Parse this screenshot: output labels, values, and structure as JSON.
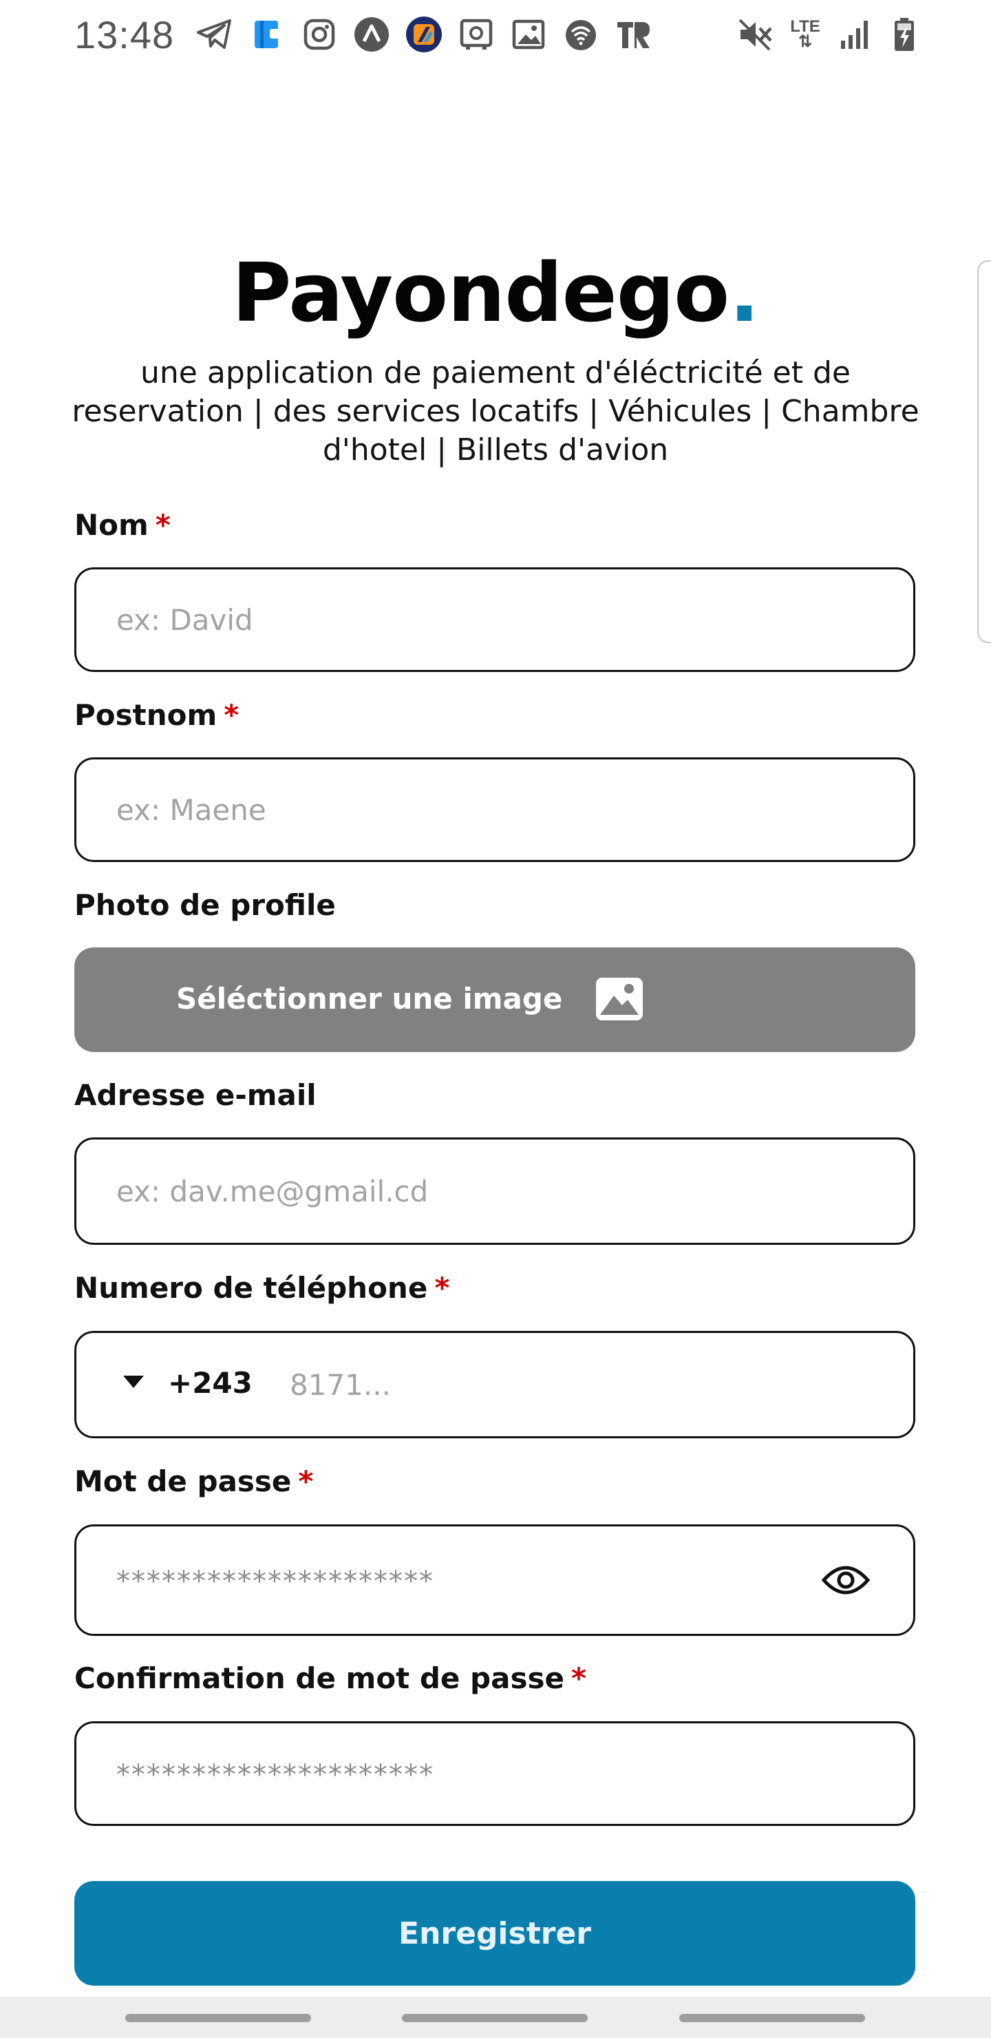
{
  "status_bar": {
    "time": "13:48",
    "left_icons": [
      "telegram-icon",
      "wallet-app-icon",
      "instagram-icon",
      "arc-app-icon",
      "boosty-app-icon",
      "safe-app-icon",
      "gallery-icon",
      "wifi-calling-icon",
      "tr-app-icon"
    ],
    "right_icons": [
      "mute-icon",
      "lte-icon",
      "signal-icon",
      "battery-charging-icon"
    ],
    "lte_label": "LTE"
  },
  "header": {
    "brand": "Payondego",
    "brand_dot": ".",
    "subtitle": "une application de paiement d'éléctricité et de reservation | des services locatifs | Véhicules | Chambre d'hotel | Billets d'avion"
  },
  "form": {
    "required_mark": "*",
    "nom": {
      "label": "Nom",
      "placeholder": "ex: David",
      "value": ""
    },
    "postnom": {
      "label": "Postnom",
      "placeholder": "ex: Maene",
      "value": ""
    },
    "photo": {
      "label": "Photo de profile",
      "button_label": "Séléctionner une image",
      "icon": "image-icon"
    },
    "email": {
      "label": "Adresse e-mail",
      "placeholder": "ex: dav.me@gmail.cd",
      "value": ""
    },
    "phone": {
      "label": "Numero de téléphone",
      "country_code": "+243",
      "placeholder": "8171...",
      "value": ""
    },
    "password": {
      "label": "Mot de passe",
      "placeholder": "*********************",
      "value": ""
    },
    "password_confirm": {
      "label": "Confirmation de mot de passe",
      "placeholder": "*********************",
      "value": ""
    },
    "submit_label": "Enregistrer"
  },
  "colors": {
    "accent": "#0a7fae",
    "required": "#d10000",
    "image_button": "#818181"
  }
}
